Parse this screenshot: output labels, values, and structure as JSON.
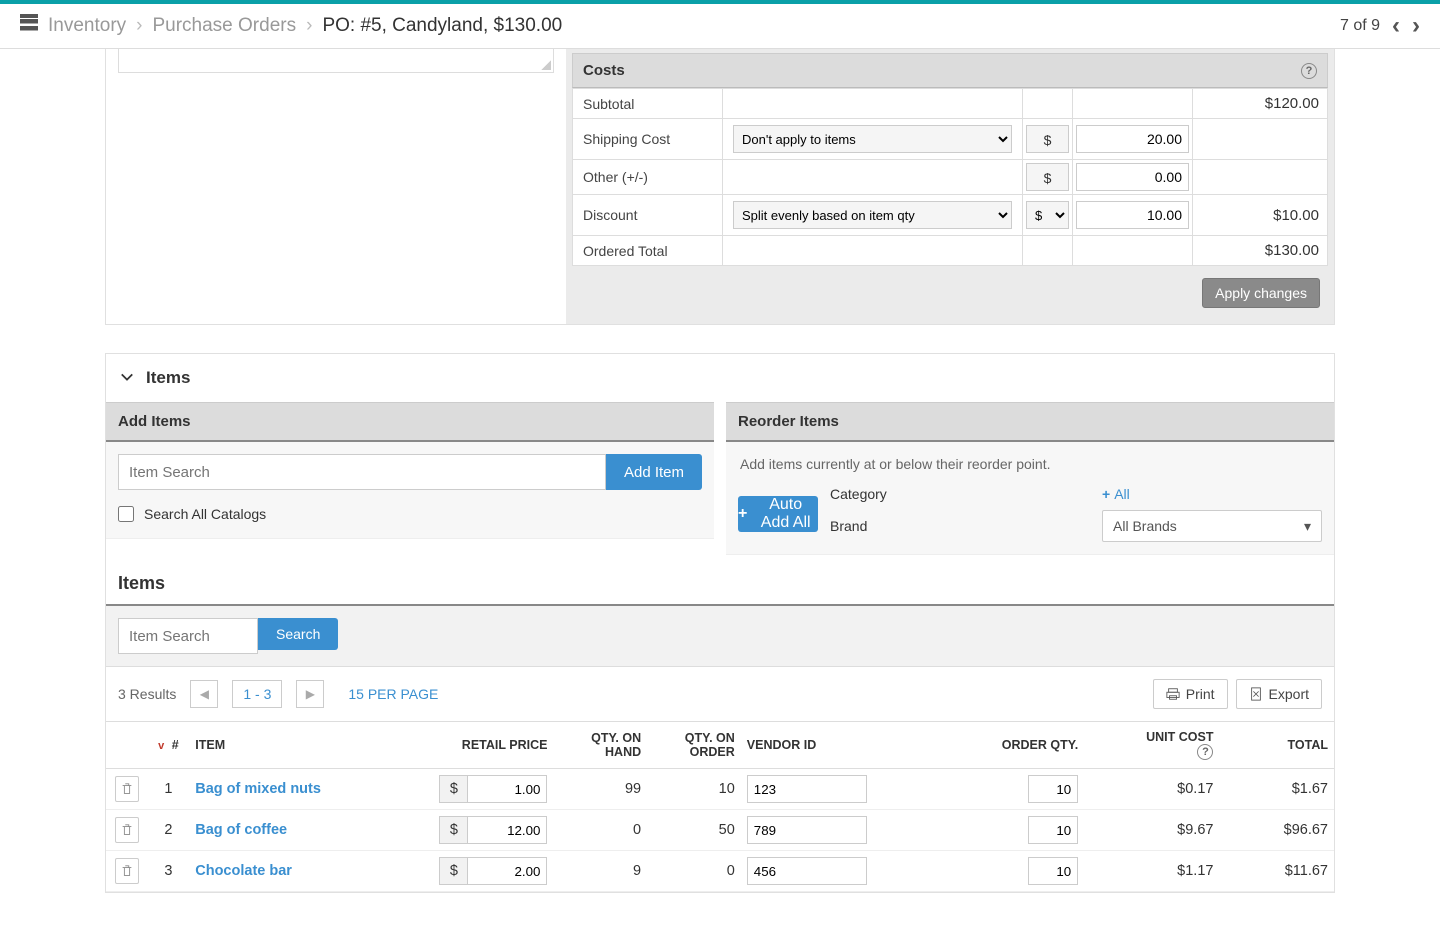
{
  "breadcrumb": {
    "inventory": "Inventory",
    "po": "Purchase Orders",
    "current": "PO:  #5, Candyland, $130.00"
  },
  "pager": {
    "text": "7 of 9"
  },
  "costs": {
    "title": "Costs",
    "rows": {
      "subtotal_label": "Subtotal",
      "subtotal_value": "$120.00",
      "shipping_label": "Shipping Cost",
      "shipping_select": "Don't apply to items",
      "shipping_symbol": "$",
      "shipping_amount": "20.00",
      "other_label": "Other (+/-)",
      "other_symbol": "$",
      "other_amount": "0.00",
      "discount_label": "Discount",
      "discount_select": "Split evenly based on item qty",
      "discount_symbol": "$",
      "discount_amount": "10.00",
      "discount_total": "$10.00",
      "ordered_label": "Ordered Total",
      "ordered_value": "$130.00"
    },
    "apply_btn": "Apply changes"
  },
  "items_section": {
    "header": "Items",
    "add_title": "Add Items",
    "add_placeholder": "Item Search",
    "add_btn": "Add Item",
    "search_all_label": "Search All Catalogs",
    "reorder_title": "Reorder Items",
    "reorder_note": "Add items currently at or below their reorder point.",
    "category_label": "Category",
    "category_all": "All",
    "brand_label": "Brand",
    "brand_value": "All Brands",
    "auto_btn": "Auto Add All"
  },
  "items_list": {
    "title": "Items",
    "search_placeholder": "Item Search",
    "search_btn": "Search",
    "results_text": "3 Results",
    "page_range": "1 - 3",
    "per_page": "15 PER PAGE",
    "print_btn": "Print",
    "export_btn": "Export",
    "headers": {
      "num": "#",
      "item": "ITEM",
      "retail": "RETAIL PRICE",
      "onhand": "QTY. ON HAND",
      "onorder": "QTY. ON ORDER",
      "vendor": "VENDOR ID",
      "orderqty": "ORDER QTY.",
      "unitcost": "UNIT COST",
      "total": "TOTAL"
    },
    "rows": [
      {
        "num": "1",
        "item": "Bag of mixed nuts",
        "retail": "1.00",
        "onhand": "99",
        "onorder": "10",
        "vendor": "123",
        "orderqty": "10",
        "unitcost": "$0.17",
        "total": "$1.67"
      },
      {
        "num": "2",
        "item": "Bag of coffee",
        "retail": "12.00",
        "onhand": "0",
        "onorder": "50",
        "vendor": "789",
        "orderqty": "10",
        "unitcost": "$9.67",
        "total": "$96.67"
      },
      {
        "num": "3",
        "item": "Chocolate bar",
        "retail": "2.00",
        "onhand": "9",
        "onorder": "0",
        "vendor": "456",
        "orderqty": "10",
        "unitcost": "$1.17",
        "total": "$11.67"
      }
    ]
  }
}
